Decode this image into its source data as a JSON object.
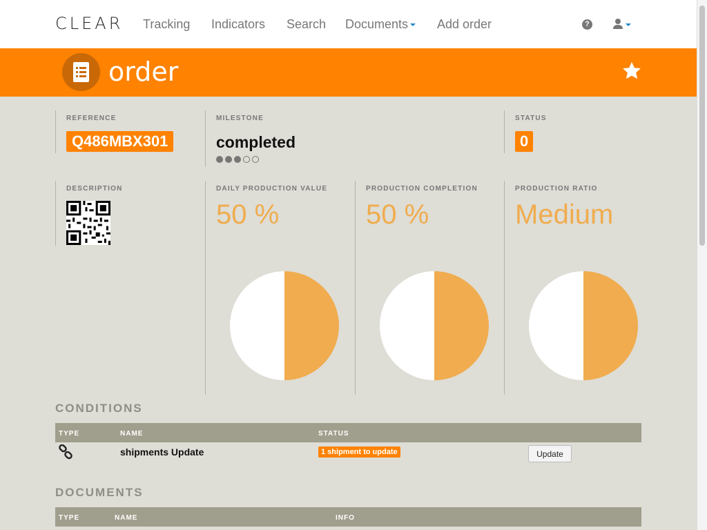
{
  "nav": {
    "brand": "CLEAR",
    "items": [
      "Tracking",
      "Indicators",
      "Search",
      "Documents",
      "Add order"
    ],
    "help_icon": "question-circle-icon",
    "user_icon": "user-icon"
  },
  "header": {
    "title": "order",
    "icon": "document-list-icon",
    "star_icon": "star-icon",
    "bg_color": "#ff8200"
  },
  "summary": {
    "reference": {
      "label": "REFERENCE",
      "value": "Q486MBX301"
    },
    "milestone": {
      "label": "MILESTONE",
      "value": "completed",
      "steps_done": 3,
      "steps_total": 5
    },
    "status": {
      "label": "STATUS",
      "value": "0"
    }
  },
  "metrics": {
    "description": {
      "label": "DESCRIPTION",
      "icon": "qr-code-icon"
    },
    "daily_production": {
      "label": "DAILY PRODUCTION VALUE",
      "value": "50 %"
    },
    "production_completion": {
      "label": "PRODUCTION COMPLETION",
      "value": "50 %"
    },
    "production_ratio": {
      "label": "PRODUCTION RATIO",
      "value": "Medium"
    }
  },
  "chart_data": [
    {
      "type": "pie",
      "values": [
        50,
        50
      ],
      "colors": [
        "#f0ac4e",
        "#ffffff"
      ]
    },
    {
      "type": "pie",
      "values": [
        50,
        50
      ],
      "colors": [
        "#f0ac4e",
        "#ffffff"
      ]
    },
    {
      "type": "pie",
      "values": [
        50,
        50
      ],
      "colors": [
        "#f0ac4e",
        "#ffffff"
      ]
    }
  ],
  "conditions": {
    "title": "CONDITIONS",
    "columns": [
      "TYPE",
      "NAME",
      "STATUS"
    ],
    "rows": [
      {
        "type_icon": "link-icon",
        "name": "shipments Update",
        "status": "1 shipment to update",
        "action": "Update"
      }
    ]
  },
  "documents": {
    "title": "DOCUMENTS",
    "columns": [
      "TYPE",
      "NAME",
      "INFO"
    ]
  }
}
